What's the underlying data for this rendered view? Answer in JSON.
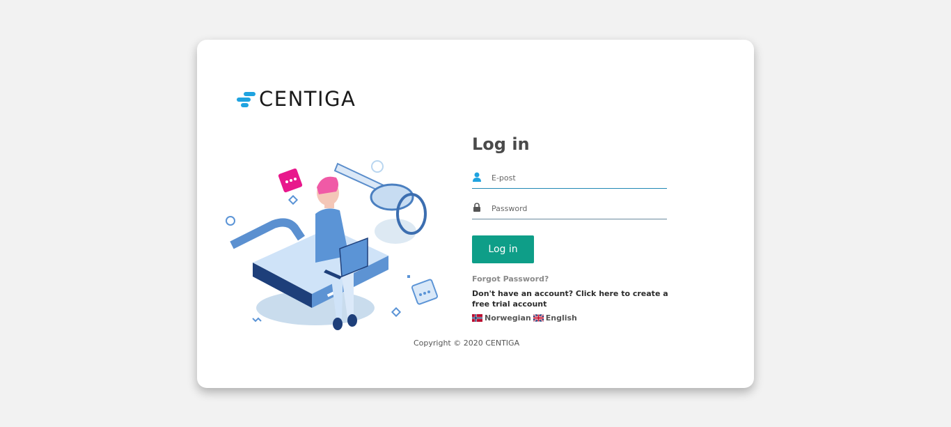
{
  "brand": {
    "name": "CENTIGA"
  },
  "login": {
    "title": "Log in",
    "email_placeholder": "E-post",
    "password_placeholder": "Password",
    "submit_label": "Log in",
    "forgot_label": "Forgot Password?",
    "signup_text": "Don't have an account? Click here to create a free trial account"
  },
  "languages": [
    {
      "label": "Norwegian",
      "flag": "norway-flag-icon"
    },
    {
      "label": "English",
      "flag": "uk-flag-icon"
    }
  ],
  "footer": {
    "copyright": "Copyright © 2020 CENTIGA"
  },
  "colors": {
    "accent": "#0e9e88",
    "brand_blue": "#1fa3e0",
    "field_line": "#1f87b5",
    "background": "#f2f2f2"
  }
}
